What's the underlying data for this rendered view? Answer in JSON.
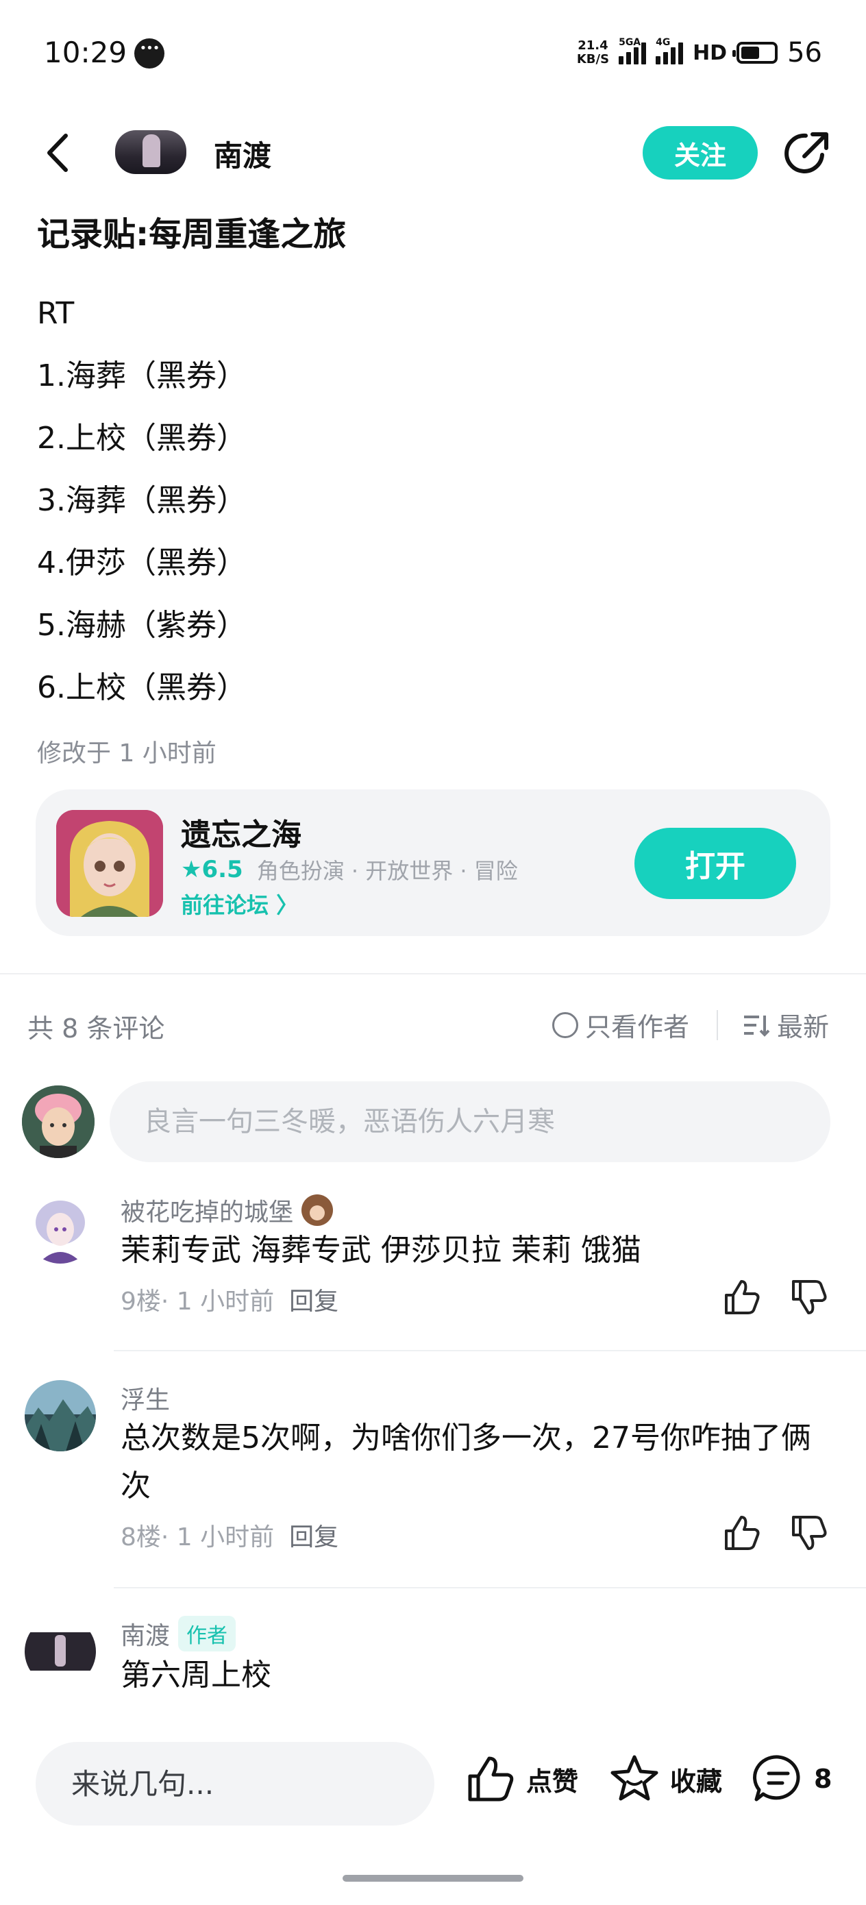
{
  "status_bar": {
    "time": "10:29",
    "net_speed_line1": "21.4",
    "net_speed_line2": "KB/S",
    "sim1_tag": "5GA",
    "sim2_tag": "4G",
    "hd_label": "HD",
    "battery": "56"
  },
  "header": {
    "author_name": "南渡",
    "follow_label": "关注"
  },
  "post": {
    "title": "记录贴:每周重逢之旅",
    "lines": [
      "RT",
      "1.海葬（黑券）",
      "2.上校（黑券）",
      "3.海葬（黑券）",
      "4.伊莎（黑券）",
      "5.海赫（紫券）",
      "6.上校（黑券）"
    ],
    "modified": "修改于 1 小时前"
  },
  "game_card": {
    "name": "遗忘之海",
    "rating": "★6.5",
    "tags": "角色扮演 · 开放世界 · 冒险",
    "forum_link": "前往论坛 〉",
    "open_label": "打开"
  },
  "comments_header": {
    "count": "共 8 条评论",
    "author_only": "只看作者",
    "sort": "最新"
  },
  "comment_input": {
    "placeholder": "良言一句三冬暖，恶语伤人六月寒"
  },
  "comments": [
    {
      "user": "被花吃掉的城堡",
      "text": "茉莉专武 海葬专武 伊莎贝拉 茉莉 饿猫",
      "floor": "9楼",
      "time": "· 1 小时前",
      "reply": "回复"
    },
    {
      "user": "浮生",
      "text": "总次数是5次啊，为啥你们多一次，27号你咋抽了俩次",
      "floor": "8楼",
      "time": "· 1 小时前",
      "reply": "回复"
    },
    {
      "user": "南渡",
      "author_tag": "作者",
      "text": "第六周上校"
    }
  ],
  "bottom_bar": {
    "input_placeholder": "来说几句...",
    "like_label": "点赞",
    "fav_label": "收藏",
    "comment_count": "8"
  },
  "colors": {
    "accent": "#17d1be",
    "accent_text": "#17c1ae",
    "muted": "#7a7e86"
  }
}
